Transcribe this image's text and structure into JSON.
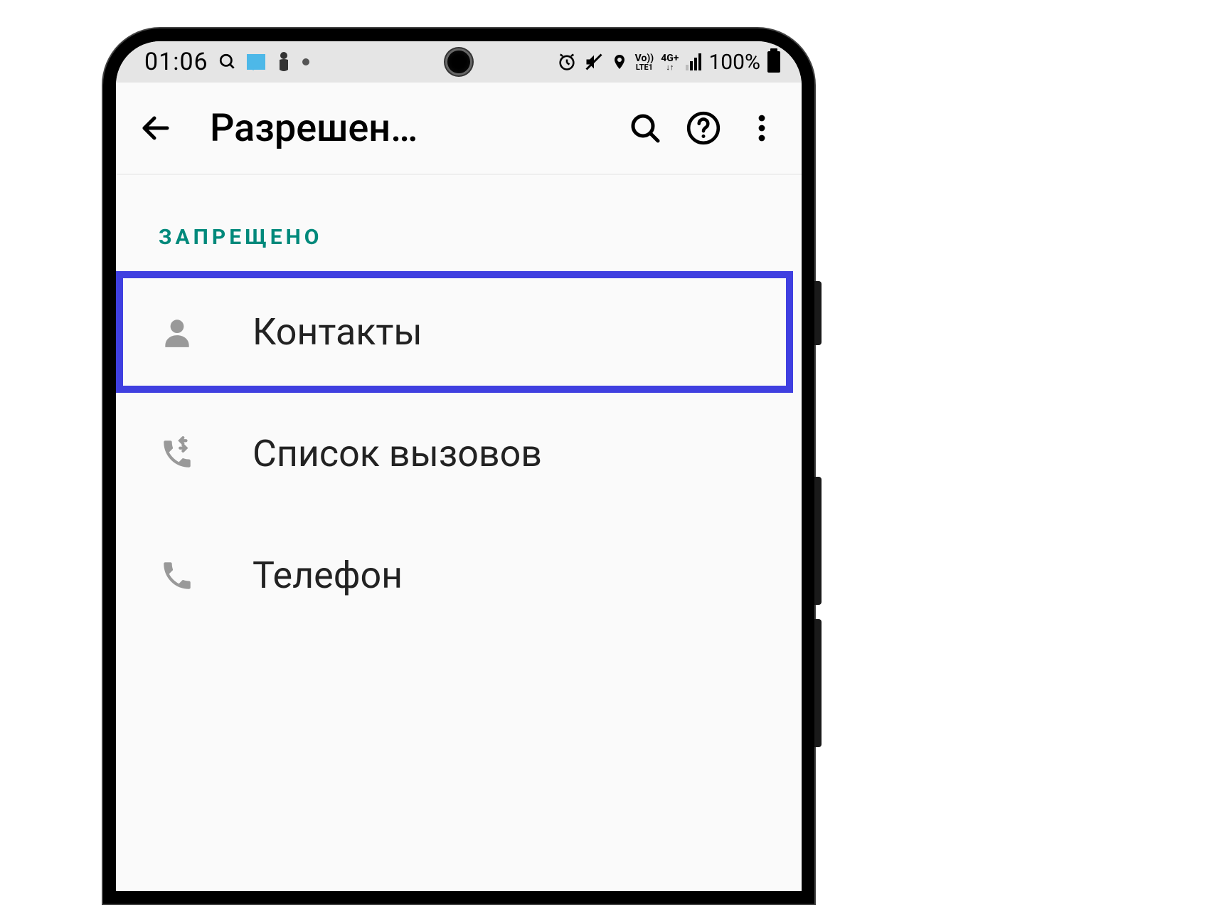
{
  "status_bar": {
    "time": "01:06",
    "battery": "100%",
    "network1": "Vo))",
    "network1_sub": "LTE1",
    "network2": "4G+"
  },
  "toolbar": {
    "title": "Разрешен…"
  },
  "section": {
    "header": "ЗАПРЕЩЕНО"
  },
  "permissions": [
    {
      "label": "Контакты",
      "icon": "contacts"
    },
    {
      "label": "Список вызовов",
      "icon": "call-log"
    },
    {
      "label": "Телефон",
      "icon": "phone"
    }
  ]
}
